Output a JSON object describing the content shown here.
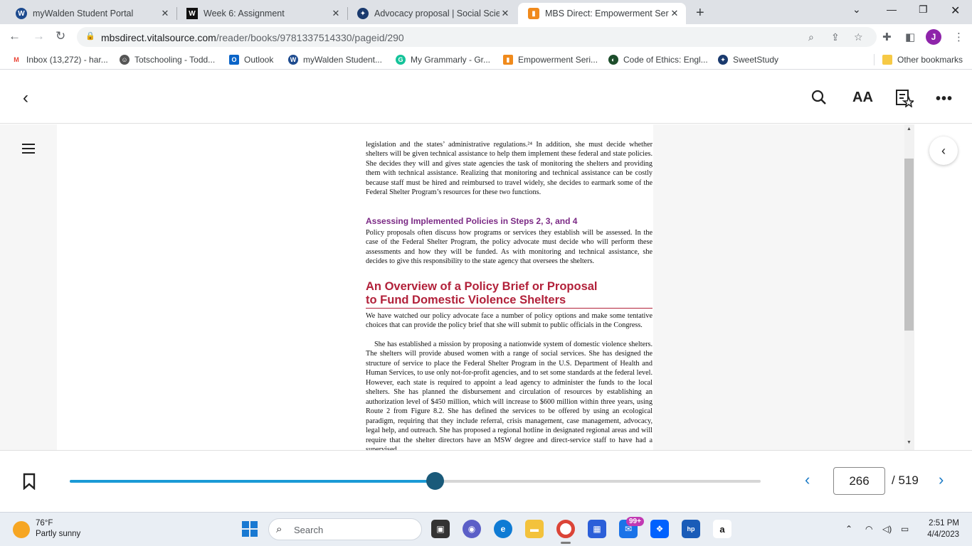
{
  "browser": {
    "tabs": [
      {
        "title": "myWalden Student Portal",
        "icon": "walden-icon",
        "active": false
      },
      {
        "title": "Week 6: Assignment",
        "icon": "walden-w-icon",
        "active": false
      },
      {
        "title": "Advocacy proposal | Social Scienc",
        "icon": "sweetstudy-icon",
        "active": false
      },
      {
        "title": "MBS Direct: Empowerment Series",
        "icon": "mbs-icon",
        "active": true
      }
    ],
    "url_host": "mbsdirect.vitalsource.com",
    "url_path": "/reader/books/9781337514330/pageid/290",
    "profile_initial": "J",
    "bookmarks": [
      {
        "label": "Inbox (13,272) - har...",
        "icon": "gmail-icon"
      },
      {
        "label": "Totschooling - Todd...",
        "icon": "totschooling-icon"
      },
      {
        "label": "Outlook",
        "icon": "outlook-icon"
      },
      {
        "label": "myWalden Student...",
        "icon": "walden-icon"
      },
      {
        "label": "My Grammarly - Gr...",
        "icon": "grammarly-icon"
      },
      {
        "label": "Empowerment Seri...",
        "icon": "mbs-icon"
      },
      {
        "label": "Code of Ethics: Engl...",
        "icon": "nasw-icon"
      },
      {
        "label": "SweetStudy",
        "icon": "sweetstudy-icon"
      }
    ],
    "other_bookmarks": "Other bookmarks"
  },
  "reader": {
    "text_size_label": "AA",
    "paragraph1": "legislation and the states’ administrative regulations.²⁴ In addition, she must decide whether shelters will be given technical assistance to help them implement these federal and state policies. She decides they will and gives state agencies the task of monitoring the shelters and providing them with technical assistance. Realizing that monitoring and technical assistance can be costly because staff must be hired and reimbursed to travel widely, she decides to earmark some of the Federal Shelter Program’s resources for these two functions.",
    "heading3": "Assessing Implemented Policies in Steps 2, 3, and 4",
    "paragraph2": "Policy proposals often discuss how programs or services they establish will be assessed. In the case of the Federal Shelter Program, the policy advocate must decide who will perform these assessments and how they will be funded. As with monitoring and technical assistance, she decides to give this responsibility to the state agency that oversees the shelters.",
    "heading2_line1": "An Overview of a Policy Brief or Proposal",
    "heading2_line2": "to Fund Domestic Violence Shelters",
    "paragraph3": "We have watched our policy advocate face a number of policy options and make some tentative choices that can provide the policy brief that she will submit to public officials in the Congress.",
    "paragraph4": "She has established a mission by proposing a nationwide system of domestic violence shelters. The shelters will provide abused women with a range of social services. She has designed the structure of service to place the Federal Shelter Program in the U.S. Department of Health and Human Services, to use only not-for-profit agencies, and to set some standards at the federal level. However, each state is required to appoint a lead agency to administer the funds to the local shelters. She has planned the disbursement and circulation of resources by establishing an authorization level of $450 million, which will increase to $600 million within three years, using Route 2 from Figure 8.2. She has defined the services to be offered by using an ecological paradigm, requiring that they include referral, crisis management, case management, advocacy, legal help, and outreach. She has proposed a regional hotline in designated regional areas and will require that the shelter directors have an MSW degree and direct-service staff to have had a supervised",
    "current_page": "266",
    "total_pages": "/ 519",
    "progress": 0.528
  },
  "taskbar": {
    "temperature": "76°F",
    "weather": "Partly sunny",
    "search_label": "Search",
    "mail_badge": "99+",
    "time": "2:51 PM",
    "date": "4/4/2023"
  }
}
